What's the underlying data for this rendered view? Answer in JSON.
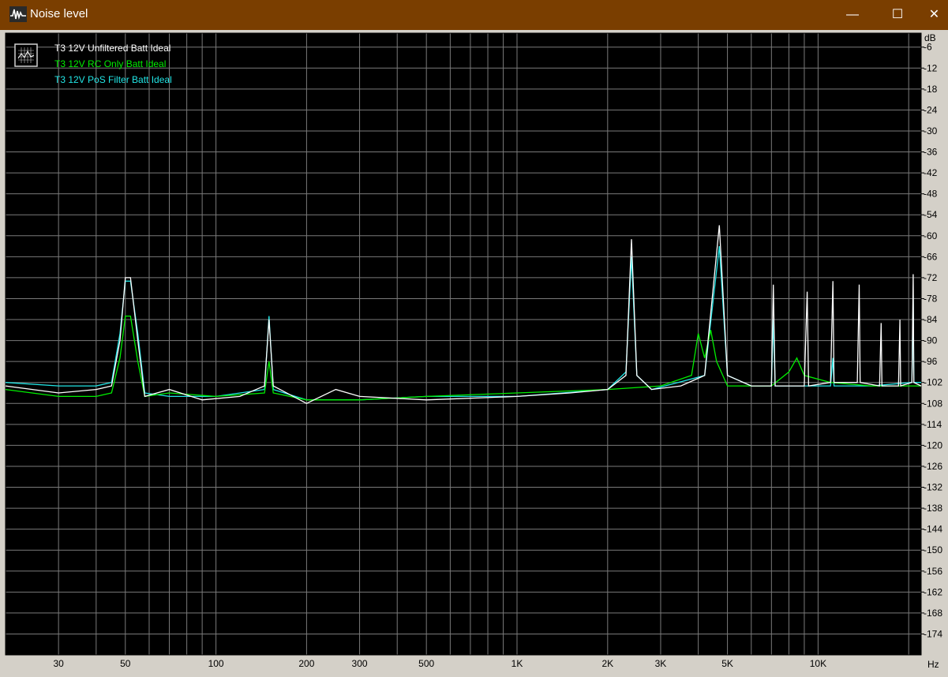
{
  "window": {
    "title": "Noise level",
    "minimize_glyph": "—",
    "maximize_glyph": "☐",
    "close_glyph": "✕",
    "titlebar_color": "#7a3e00"
  },
  "chart_data": {
    "type": "line",
    "title": "",
    "xlabel": "Hz",
    "ylabel": "dB",
    "x_scale": "log",
    "xlim": [
      20,
      22000
    ],
    "ylim": [
      -180,
      -2
    ],
    "grid": true,
    "background": "#000000",
    "legend_placement": "top-left",
    "y_ticks": [
      -6,
      -12,
      -18,
      -24,
      -30,
      -36,
      -42,
      -48,
      -54,
      -60,
      -66,
      -72,
      -78,
      -84,
      -90,
      -96,
      -102,
      -108,
      -114,
      -120,
      -126,
      -132,
      -138,
      -144,
      -150,
      -156,
      -162,
      -168,
      -174
    ],
    "x_ticks": [
      {
        "value": 30,
        "label": "30"
      },
      {
        "value": 50,
        "label": "50"
      },
      {
        "value": 100,
        "label": "100"
      },
      {
        "value": 200,
        "label": "200"
      },
      {
        "value": 300,
        "label": "300"
      },
      {
        "value": 500,
        "label": "500"
      },
      {
        "value": 1000,
        "label": "1K"
      },
      {
        "value": 2000,
        "label": "2K"
      },
      {
        "value": 3000,
        "label": "3K"
      },
      {
        "value": 5000,
        "label": "5K"
      },
      {
        "value": 10000,
        "label": "10K"
      }
    ],
    "series": [
      {
        "name": "T3 12V Unfiltered Batt Ideal",
        "color": "#ffffff",
        "points": [
          [
            20,
            -103
          ],
          [
            30,
            -105
          ],
          [
            40,
            -104
          ],
          [
            45,
            -103
          ],
          [
            48,
            -90
          ],
          [
            50,
            -72
          ],
          [
            52,
            -72
          ],
          [
            55,
            -90
          ],
          [
            58,
            -106
          ],
          [
            70,
            -104
          ],
          [
            90,
            -107
          ],
          [
            120,
            -106
          ],
          [
            145,
            -103
          ],
          [
            150,
            -84
          ],
          [
            155,
            -103
          ],
          [
            200,
            -108
          ],
          [
            250,
            -104
          ],
          [
            300,
            -106
          ],
          [
            500,
            -107
          ],
          [
            1000,
            -106
          ],
          [
            1500,
            -105
          ],
          [
            2000,
            -104
          ],
          [
            2300,
            -100
          ],
          [
            2400,
            -61
          ],
          [
            2500,
            -100
          ],
          [
            2800,
            -104
          ],
          [
            3500,
            -103
          ],
          [
            4200,
            -100
          ],
          [
            4700,
            -57
          ],
          [
            5000,
            -100
          ],
          [
            6000,
            -103
          ],
          [
            7000,
            -103
          ],
          [
            7100,
            -74
          ],
          [
            7200,
            -103
          ],
          [
            9000,
            -103
          ],
          [
            9200,
            -76
          ],
          [
            9300,
            -103
          ],
          [
            11000,
            -102
          ],
          [
            11200,
            -73
          ],
          [
            11300,
            -102
          ],
          [
            13500,
            -102
          ],
          [
            13700,
            -74
          ],
          [
            13800,
            -102
          ],
          [
            16000,
            -103
          ],
          [
            16200,
            -85
          ],
          [
            16300,
            -103
          ],
          [
            18500,
            -103
          ],
          [
            18700,
            -84
          ],
          [
            18800,
            -103
          ],
          [
            20500,
            -102
          ],
          [
            20700,
            -71
          ],
          [
            20800,
            -102
          ],
          [
            22000,
            -103
          ]
        ]
      },
      {
        "name": "T3 12V RC Only Batt Ideal",
        "color": "#00ee00",
        "points": [
          [
            20,
            -104
          ],
          [
            30,
            -106
          ],
          [
            40,
            -106
          ],
          [
            45,
            -105
          ],
          [
            48,
            -95
          ],
          [
            50,
            -83
          ],
          [
            52,
            -83
          ],
          [
            55,
            -96
          ],
          [
            58,
            -106
          ],
          [
            70,
            -105
          ],
          [
            100,
            -106
          ],
          [
            145,
            -105
          ],
          [
            150,
            -96
          ],
          [
            155,
            -105
          ],
          [
            200,
            -107
          ],
          [
            300,
            -107
          ],
          [
            500,
            -106
          ],
          [
            1000,
            -105
          ],
          [
            2000,
            -104
          ],
          [
            3000,
            -103
          ],
          [
            3800,
            -100
          ],
          [
            4000,
            -88
          ],
          [
            4200,
            -95
          ],
          [
            4400,
            -87
          ],
          [
            4600,
            -96
          ],
          [
            5000,
            -103
          ],
          [
            7000,
            -103
          ],
          [
            8000,
            -99
          ],
          [
            8500,
            -95
          ],
          [
            9000,
            -100
          ],
          [
            11000,
            -102
          ],
          [
            15000,
            -103
          ],
          [
            20000,
            -103
          ],
          [
            22000,
            -103
          ]
        ]
      },
      {
        "name": "T3 12V PoS Filter Batt Ideal",
        "color": "#22e5e5",
        "points": [
          [
            20,
            -102
          ],
          [
            30,
            -103
          ],
          [
            40,
            -103
          ],
          [
            45,
            -102
          ],
          [
            48,
            -88
          ],
          [
            50,
            -73
          ],
          [
            52,
            -73
          ],
          [
            55,
            -88
          ],
          [
            58,
            -105
          ],
          [
            70,
            -106
          ],
          [
            100,
            -106
          ],
          [
            145,
            -104
          ],
          [
            150,
            -83
          ],
          [
            155,
            -104
          ],
          [
            200,
            -107
          ],
          [
            300,
            -107
          ],
          [
            500,
            -106
          ],
          [
            1000,
            -106
          ],
          [
            2000,
            -104
          ],
          [
            2300,
            -99
          ],
          [
            2400,
            -66
          ],
          [
            2500,
            -100
          ],
          [
            2800,
            -104
          ],
          [
            4200,
            -100
          ],
          [
            4700,
            -63
          ],
          [
            5000,
            -100
          ],
          [
            6000,
            -103
          ],
          [
            7000,
            -103
          ],
          [
            7100,
            -84
          ],
          [
            7200,
            -103
          ],
          [
            11000,
            -103
          ],
          [
            11200,
            -95
          ],
          [
            11300,
            -103
          ],
          [
            15000,
            -103
          ],
          [
            20500,
            -102
          ],
          [
            20700,
            -77
          ],
          [
            20800,
            -102
          ],
          [
            22000,
            -102
          ]
        ]
      }
    ]
  }
}
